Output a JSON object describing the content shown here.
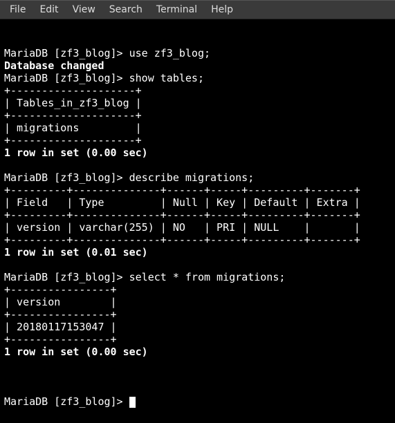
{
  "menubar": {
    "items": [
      "File",
      "Edit",
      "View",
      "Search",
      "Terminal",
      "Help"
    ]
  },
  "terminal": {
    "lines": [
      {
        "text": "MariaDB [zf3_blog]> use zf3_blog;",
        "bold": false
      },
      {
        "text": "Database changed",
        "bold": true
      },
      {
        "text": "MariaDB [zf3_blog]> show tables;",
        "bold": false
      },
      {
        "text": "+--------------------+",
        "bold": false
      },
      {
        "text": "| Tables_in_zf3_blog |",
        "bold": false
      },
      {
        "text": "+--------------------+",
        "bold": false
      },
      {
        "text": "| migrations         |",
        "bold": false
      },
      {
        "text": "+--------------------+",
        "bold": false
      },
      {
        "text": "1 row in set (0.00 sec)",
        "bold": true
      },
      {
        "text": "",
        "bold": false
      },
      {
        "text": "MariaDB [zf3_blog]> describe migrations;",
        "bold": false
      },
      {
        "text": "+---------+--------------+------+-----+---------+-------+",
        "bold": false
      },
      {
        "text": "| Field   | Type         | Null | Key | Default | Extra |",
        "bold": false
      },
      {
        "text": "+---------+--------------+------+-----+---------+-------+",
        "bold": false
      },
      {
        "text": "| version | varchar(255) | NO   | PRI | NULL    |       |",
        "bold": false
      },
      {
        "text": "+---------+--------------+------+-----+---------+-------+",
        "bold": false
      },
      {
        "text": "1 row in set (0.01 sec)",
        "bold": true
      },
      {
        "text": "",
        "bold": false
      },
      {
        "text": "MariaDB [zf3_blog]> select * from migrations;",
        "bold": false
      },
      {
        "text": "+----------------+",
        "bold": false
      },
      {
        "text": "| version        |",
        "bold": false
      },
      {
        "text": "+----------------+",
        "bold": false
      },
      {
        "text": "| 20180117153047 |",
        "bold": false
      },
      {
        "text": "+----------------+",
        "bold": false
      },
      {
        "text": "1 row in set (0.00 sec)",
        "bold": true
      },
      {
        "text": "",
        "bold": false
      }
    ],
    "prompt": "MariaDB [zf3_blog]> "
  }
}
